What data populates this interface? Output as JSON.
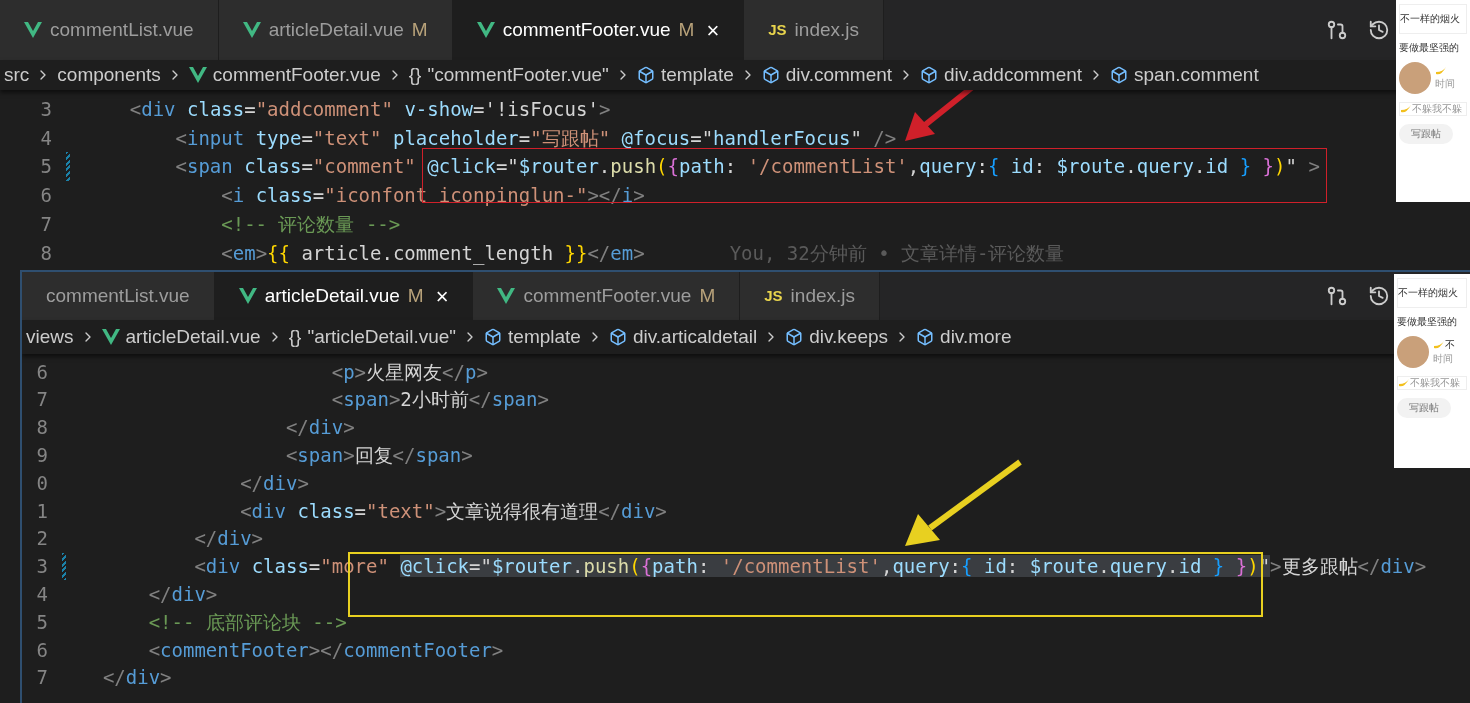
{
  "editors": [
    {
      "tabs": [
        {
          "label": "commentList.vue",
          "kind": "vue",
          "selected": false
        },
        {
          "label": "articleDetail.vue",
          "kind": "vue",
          "status": "M",
          "selected": false
        },
        {
          "label": "commentFooter.vue",
          "kind": "vue",
          "status": "M",
          "close": "×",
          "selected": true
        },
        {
          "label": "index.js",
          "kind": "js",
          "icon_text": "JS",
          "selected": false
        }
      ],
      "breadcrumbs": [
        {
          "label": "src",
          "kind": "plain"
        },
        {
          "label": "components",
          "kind": "plain"
        },
        {
          "label": "commentFooter.vue",
          "kind": "vue"
        },
        {
          "label": "\"commentFooter.vue\"",
          "kind": "object",
          "glyph": "{}"
        },
        {
          "label": "template",
          "kind": "element"
        },
        {
          "label": "div.comment",
          "kind": "element"
        },
        {
          "label": "div.addcomment",
          "kind": "element"
        },
        {
          "label": "span.comment",
          "kind": "element"
        }
      ],
      "lines": [
        {
          "number": "3",
          "modified": false,
          "code": "    <div class=\"addcomment\" v-show='!isFocus'>"
        },
        {
          "number": "4",
          "modified": false,
          "code": "        <input type=\"text\" placeholder=\"写跟帖\" @focus=\"handlerFocus\" />"
        },
        {
          "number": "5",
          "modified": true,
          "code": "        <span class=\"comment\" @click=\"$router.push({path: '/commentList',query:{ id: $route.query.id } })\" >"
        },
        {
          "number": "6",
          "modified": false,
          "code": "            <i class=\"iconfont iconpinglun-\"></i>"
        },
        {
          "number": "7",
          "modified": false,
          "code": "            <!-- 评论数量 -->"
        },
        {
          "number": "8",
          "modified": false,
          "code": "            <em>{{ article.comment_length }}</em>",
          "blame": "You, 32分钟前 • 文章详情-评论数量"
        }
      ],
      "preview": {
        "texts": [
          "不一样的烟火",
          "要做最坚强的"
        ],
        "time": "时间",
        "reply": "不躲我不躲",
        "button": "写跟帖"
      }
    },
    {
      "tabs": [
        {
          "label": "commentList.vue",
          "kind": "plain",
          "selected": false
        },
        {
          "label": "articleDetail.vue",
          "kind": "vue",
          "status": "M",
          "close": "×",
          "selected": true
        },
        {
          "label": "commentFooter.vue",
          "kind": "vue",
          "status": "M",
          "selected": false
        },
        {
          "label": "index.js",
          "kind": "js",
          "icon_text": "JS",
          "selected": false
        }
      ],
      "breadcrumbs": [
        {
          "label": "views",
          "kind": "plain"
        },
        {
          "label": "articleDetail.vue",
          "kind": "vue"
        },
        {
          "label": "\"articleDetail.vue\"",
          "kind": "object",
          "glyph": "{}"
        },
        {
          "label": "template",
          "kind": "element"
        },
        {
          "label": "div.articaldetail",
          "kind": "element"
        },
        {
          "label": "div.keeps",
          "kind": "element"
        },
        {
          "label": "div.more",
          "kind": "element"
        }
      ],
      "lines": [
        {
          "number": "6",
          "modified": false,
          "code": "                      <p>火星网友</p>"
        },
        {
          "number": "7",
          "modified": false,
          "code": "                      <span>2小时前</span>"
        },
        {
          "number": "8",
          "modified": false,
          "code": "                  </div>"
        },
        {
          "number": "9",
          "modified": false,
          "code": "                  <span>回复</span>"
        },
        {
          "number": "0",
          "modified": false,
          "code": "              </div>"
        },
        {
          "number": "1",
          "modified": false,
          "code": "              <div class=\"text\">文章说得很有道理</div>"
        },
        {
          "number": "2",
          "modified": false,
          "code": "          </div>"
        },
        {
          "number": "3",
          "modified": true,
          "code": "          <div class=\"more\" ",
          "selection": "@click=\"$router.push({path: '/commentList',query:{ id: $route.query.id } })\"",
          "code_after": ">更多跟帖</div>"
        },
        {
          "number": "4",
          "modified": false,
          "code": "      </div>"
        },
        {
          "number": "5",
          "modified": false,
          "code": "      <!-- 底部评论块 -->"
        },
        {
          "number": "6",
          "modified": false,
          "code": "      <commentFooter></commentFooter>"
        },
        {
          "number": "7",
          "modified": false,
          "code": "  </div>"
        }
      ],
      "preview": {
        "texts": [
          "不一样的烟火",
          "要做最坚强的"
        ],
        "user": "不",
        "time": "时间",
        "reply": "不躲我不躲",
        "button": "写跟帖"
      }
    }
  ],
  "annotations": [
    {
      "kind": "frame",
      "color": "#d0202a"
    },
    {
      "kind": "frame",
      "color": "#e8d020"
    }
  ]
}
